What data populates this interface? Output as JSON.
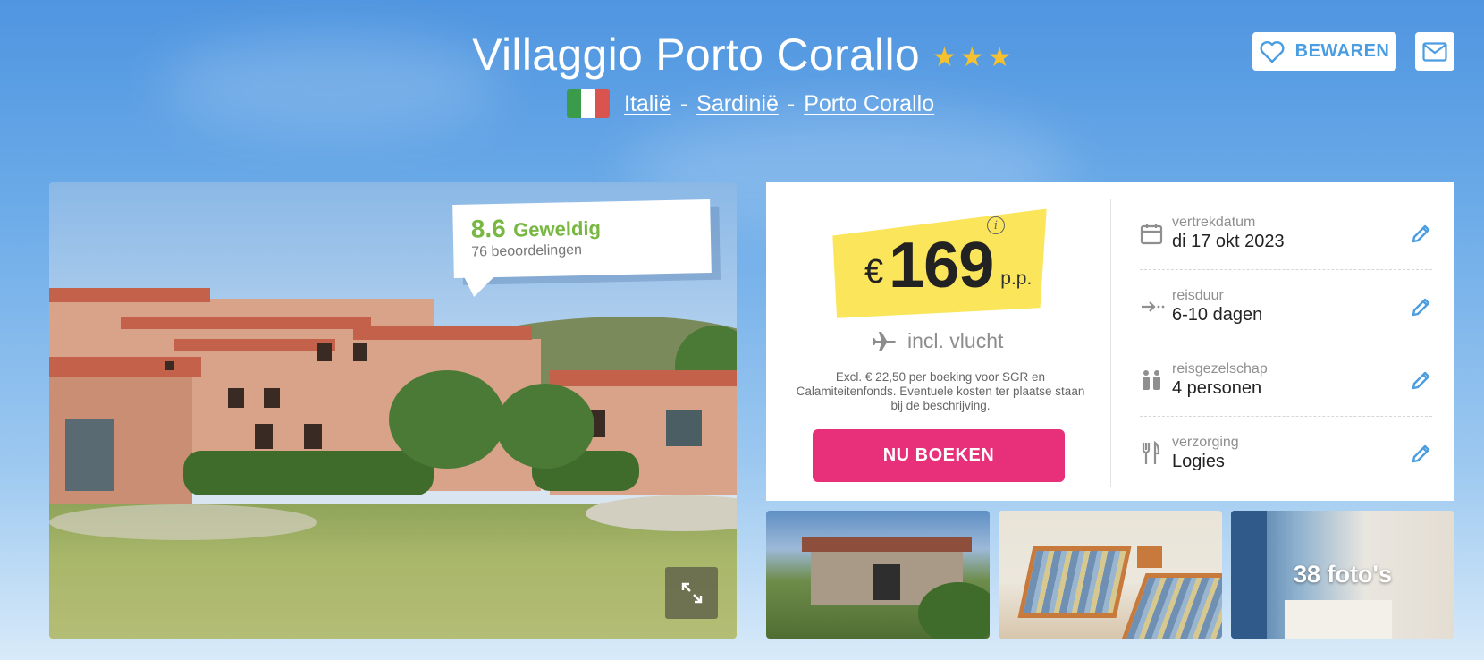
{
  "header": {
    "title": "Villaggio Porto Corallo",
    "stars": 3,
    "location": {
      "country": "Italië",
      "region": "Sardinië",
      "city": "Porto Corallo",
      "separator": "-"
    },
    "save_label": "BEWAREN"
  },
  "review": {
    "score": "8.6",
    "label": "Geweldig",
    "count_text": "76 beoordelingen"
  },
  "pricing": {
    "currency": "€",
    "amount": "169",
    "per_person": "p.p.",
    "flight_text": "incl. vlucht",
    "fine_print": "Excl. € 22,50 per boeking voor SGR en Calamiteitenfonds. Eventuele kosten ter plaatse staan bij de beschrijving.",
    "book_label": "NU BOEKEN"
  },
  "details": [
    {
      "icon": "calendar-icon",
      "label": "vertrekdatum",
      "value": "di 17 okt 2023"
    },
    {
      "icon": "duration-icon",
      "label": "reisduur",
      "value": "6-10 dagen"
    },
    {
      "icon": "people-icon",
      "label": "reisgezelschap",
      "value": "4 personen"
    },
    {
      "icon": "cutlery-icon",
      "label": "verzorging",
      "value": "Logies"
    }
  ],
  "gallery": {
    "photo_count_text": "38 foto's"
  },
  "colors": {
    "brand_pink": "#e8307a",
    "accent_blue": "#4a9de0",
    "review_green": "#78b842",
    "price_highlight": "#fbe55a",
    "star_gold": "#f5c130"
  }
}
